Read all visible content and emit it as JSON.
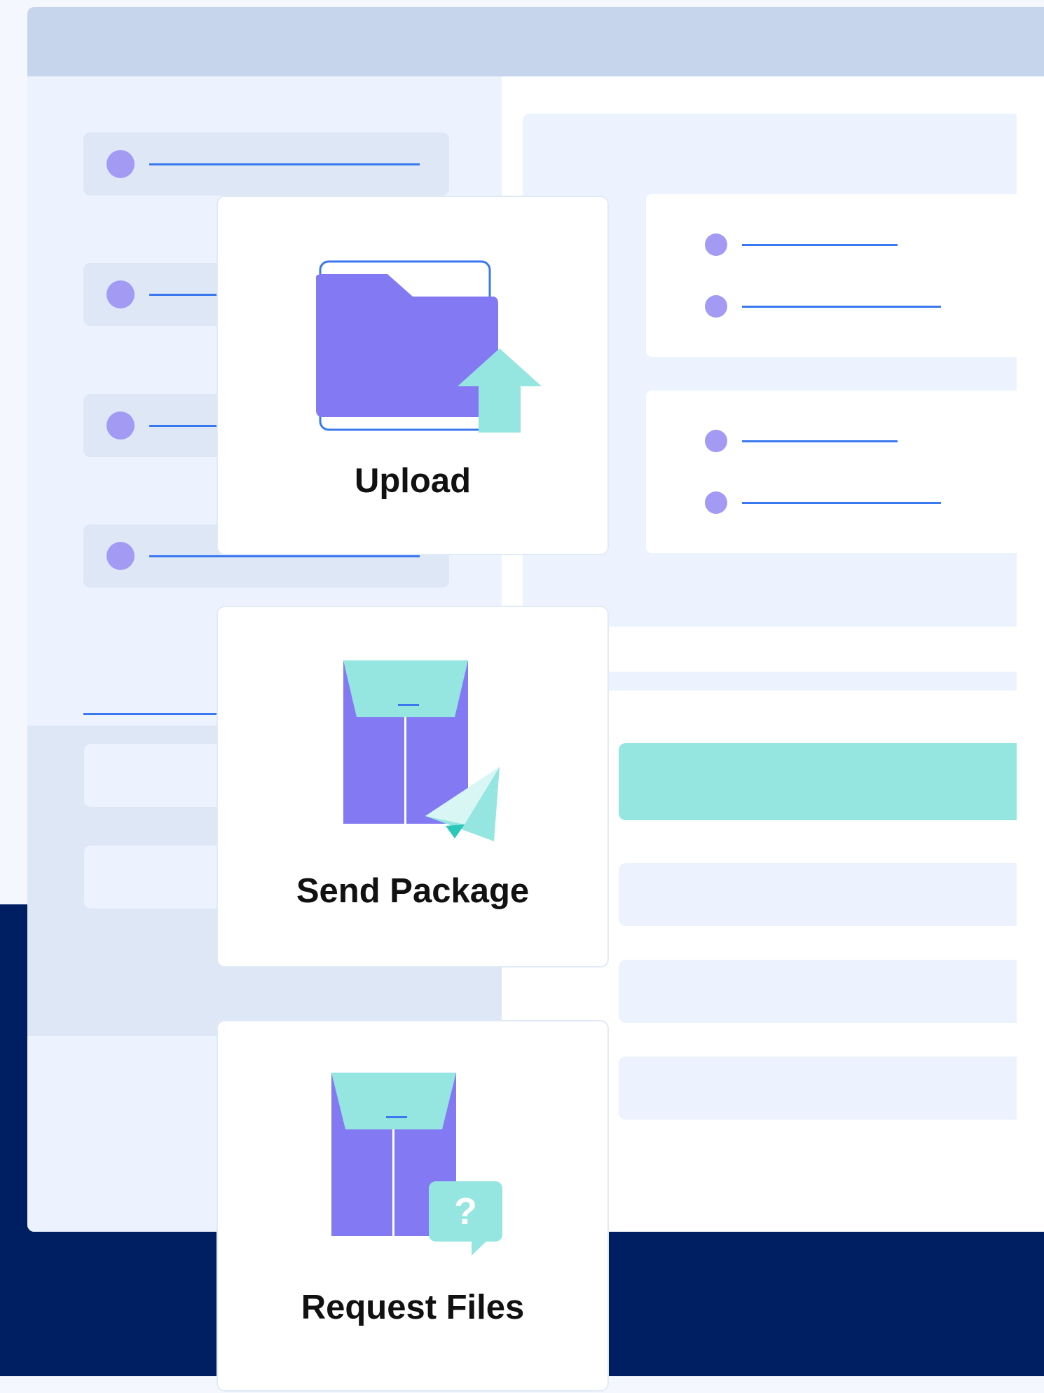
{
  "colors": {
    "navy": "#001f63",
    "titlebar": "#c6d5ec",
    "sidebar": "#edf3fe",
    "accent_blue": "#3a78f0",
    "purple": "#8379f2",
    "dot_purple": "#a39bf3",
    "teal": "#95e5e0"
  },
  "actions": [
    {
      "label": "Upload",
      "icon": "folder-upload-icon"
    },
    {
      "label": "Send Package",
      "icon": "package-send-icon"
    },
    {
      "label": "Request Files",
      "icon": "package-request-icon"
    }
  ],
  "request_icon_glyph": "?"
}
